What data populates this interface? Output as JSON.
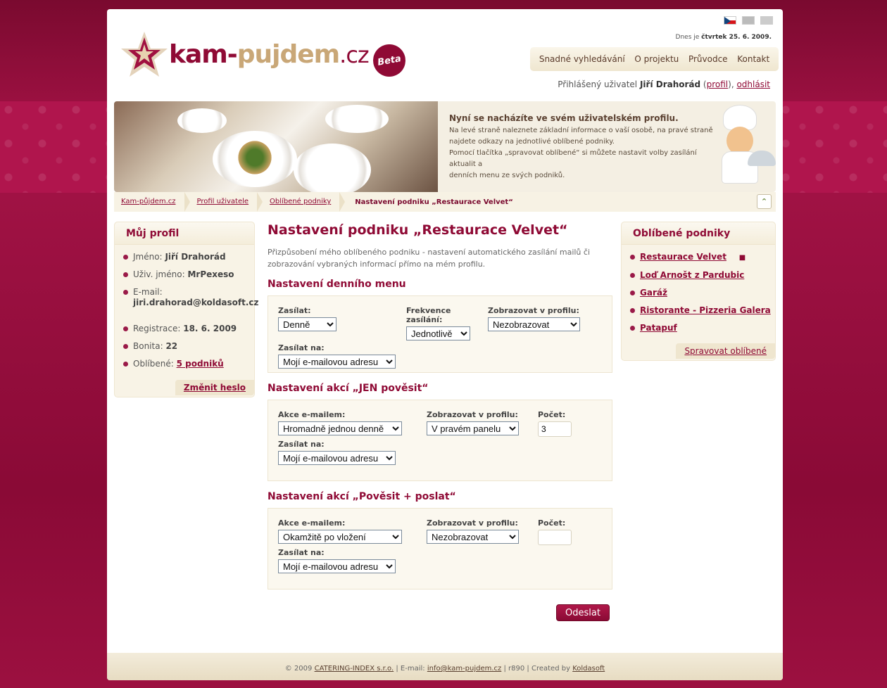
{
  "header": {
    "logo": {
      "kam": "kam",
      "dash": "-",
      "pujdem": "pujdem",
      "cz": ".cz",
      "beta": "Beta"
    },
    "date_prefix": "Dnes je",
    "date_value": "čtvrtek 25. 6. 2009.",
    "nav": [
      "Snadné vyhledávání",
      "O projektu",
      "Průvodce",
      "Kontakt"
    ],
    "user_prefix": "Přihlášený uživatel",
    "user_name": "Jiří Drahorád",
    "profile_link": "profil",
    "logout_link": "odhlásit"
  },
  "banner": {
    "title": "Nyní se nacházíte ve svém uživatelském profilu.",
    "line1": "Na levé straně naleznete základní informace o vaší osobě, na pravé straně",
    "line2": "najdete odkazy na jednotlivé oblíbené podniky.",
    "line3": "Pomocí tlačítka „spravovat oblíbené“ si můžete nastavit volby zasílání aktualit a",
    "line4": "denních menu ze svých podniků."
  },
  "breadcrumb": {
    "items": [
      "Kam-půjdem.cz",
      "Profil uživatele",
      "Oblíbené podniky"
    ],
    "current": "Nastavení podniku „Restaurace Velvet“"
  },
  "left": {
    "title": "Můj profil",
    "name_label": "Jméno:",
    "name": "Jiří Drahorád",
    "user_label": "Uživ. jméno:",
    "user": "MrPexeso",
    "email_label": "E-mail:",
    "email": "jiri.drahorad@koldasoft.cz",
    "reg_label": "Registrace:",
    "reg": "18. 6. 2009",
    "bonita_label": "Bonita:",
    "bonita": "22",
    "fav_label": "Oblíbené:",
    "fav": "5 podniků",
    "button": "Změnit heslo"
  },
  "right": {
    "title": "Oblíbené podniky",
    "items": [
      "Restaurace Velvet",
      "Loď Arnošt z Pardubic",
      "Garáž",
      "Ristorante - Pizzeria Galera",
      "Patapuf"
    ],
    "button": "Spravovat oblíbené"
  },
  "main": {
    "title": "Nastavení podniku „Restaurace Velvet“",
    "intro": "Přizpůsobení mého oblíbeného podniku - nastavení automatického zasílání mailů či zobrazování vybraných informací přímo na mém profilu.",
    "s1": {
      "title": "Nastavení denního menu",
      "send_label": "Zasílat:",
      "send": "Denně",
      "freq_label": "Frekvence zasílání:",
      "freq": "Jednotlivě",
      "show_label": "Zobrazovat v profilu:",
      "show": "Nezobrazovat",
      "to_label": "Zasílat na:",
      "to": "Mojí e-mailovou adresu"
    },
    "s2": {
      "title": "Nastavení akcí „JEN pověsit“",
      "act_label": "Akce e-mailem:",
      "act": "Hromadně jednou denně",
      "show_label": "Zobrazovat v profilu:",
      "show": "V pravém panelu",
      "count_label": "Počet:",
      "count": "3",
      "to_label": "Zasílat na:",
      "to": "Mojí e-mailovou adresu"
    },
    "s3": {
      "title": "Nastavení akcí „Pověsit + poslat“",
      "act_label": "Akce e-mailem:",
      "act": "Okamžitě po vložení",
      "show_label": "Zobrazovat v profilu:",
      "show": "Nezobrazovat",
      "count_label": "Počet:",
      "count": "",
      "to_label": "Zasílat na:",
      "to": "Mojí e-mailovou adresu"
    },
    "submit": "Odeslat"
  },
  "footer": {
    "copy": "© 2009",
    "company": "CATERING-INDEX s.r.o.",
    "email_label": "| E-mail:",
    "email": "info@kam-pujdem.cz",
    "rev": "| r890 | Created by",
    "author": "Koldasoft"
  },
  "colors": {
    "brand": "#8f0a35",
    "gold": "#c9a777",
    "panel": "#f8f3e6"
  }
}
